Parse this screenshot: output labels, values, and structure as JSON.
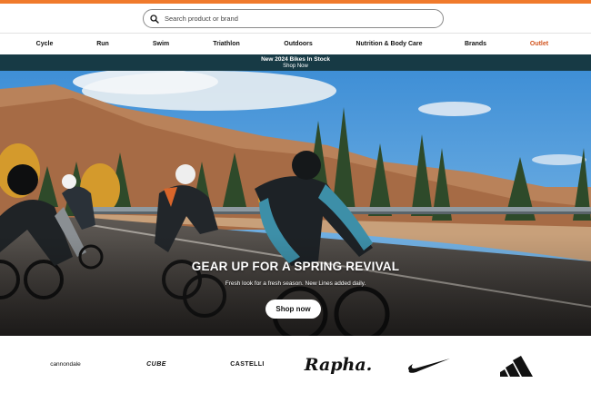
{
  "search": {
    "placeholder": "Search product or brand",
    "icon": "search-icon"
  },
  "nav": {
    "items": [
      {
        "label": "Cycle"
      },
      {
        "label": "Run"
      },
      {
        "label": "Swim"
      },
      {
        "label": "Triathlon"
      },
      {
        "label": "Outdoors"
      },
      {
        "label": "Nutrition & Body Care"
      },
      {
        "label": "Brands"
      },
      {
        "label": "Outlet"
      }
    ]
  },
  "promo": {
    "line1": "New 2024 Bikes In Stock",
    "line2": "Shop Now"
  },
  "hero": {
    "headline": "GEAR UP FOR A SPRING REVIVAL",
    "subtext": "Fresh look for a fresh season. New Lines added daily.",
    "cta": "Shop now"
  },
  "brands": [
    {
      "name": "cannondale"
    },
    {
      "name": "CUBE"
    },
    {
      "name": "CASTELLI"
    },
    {
      "name": "Rapha."
    },
    {
      "name": "Nike",
      "icon": "nike-swoosh-icon"
    },
    {
      "name": "adidas",
      "icon": "adidas-logo-icon"
    }
  ],
  "colors": {
    "accent": "#f07a2c",
    "promo_bg": "#173a45",
    "outlet": "#d2551f"
  }
}
